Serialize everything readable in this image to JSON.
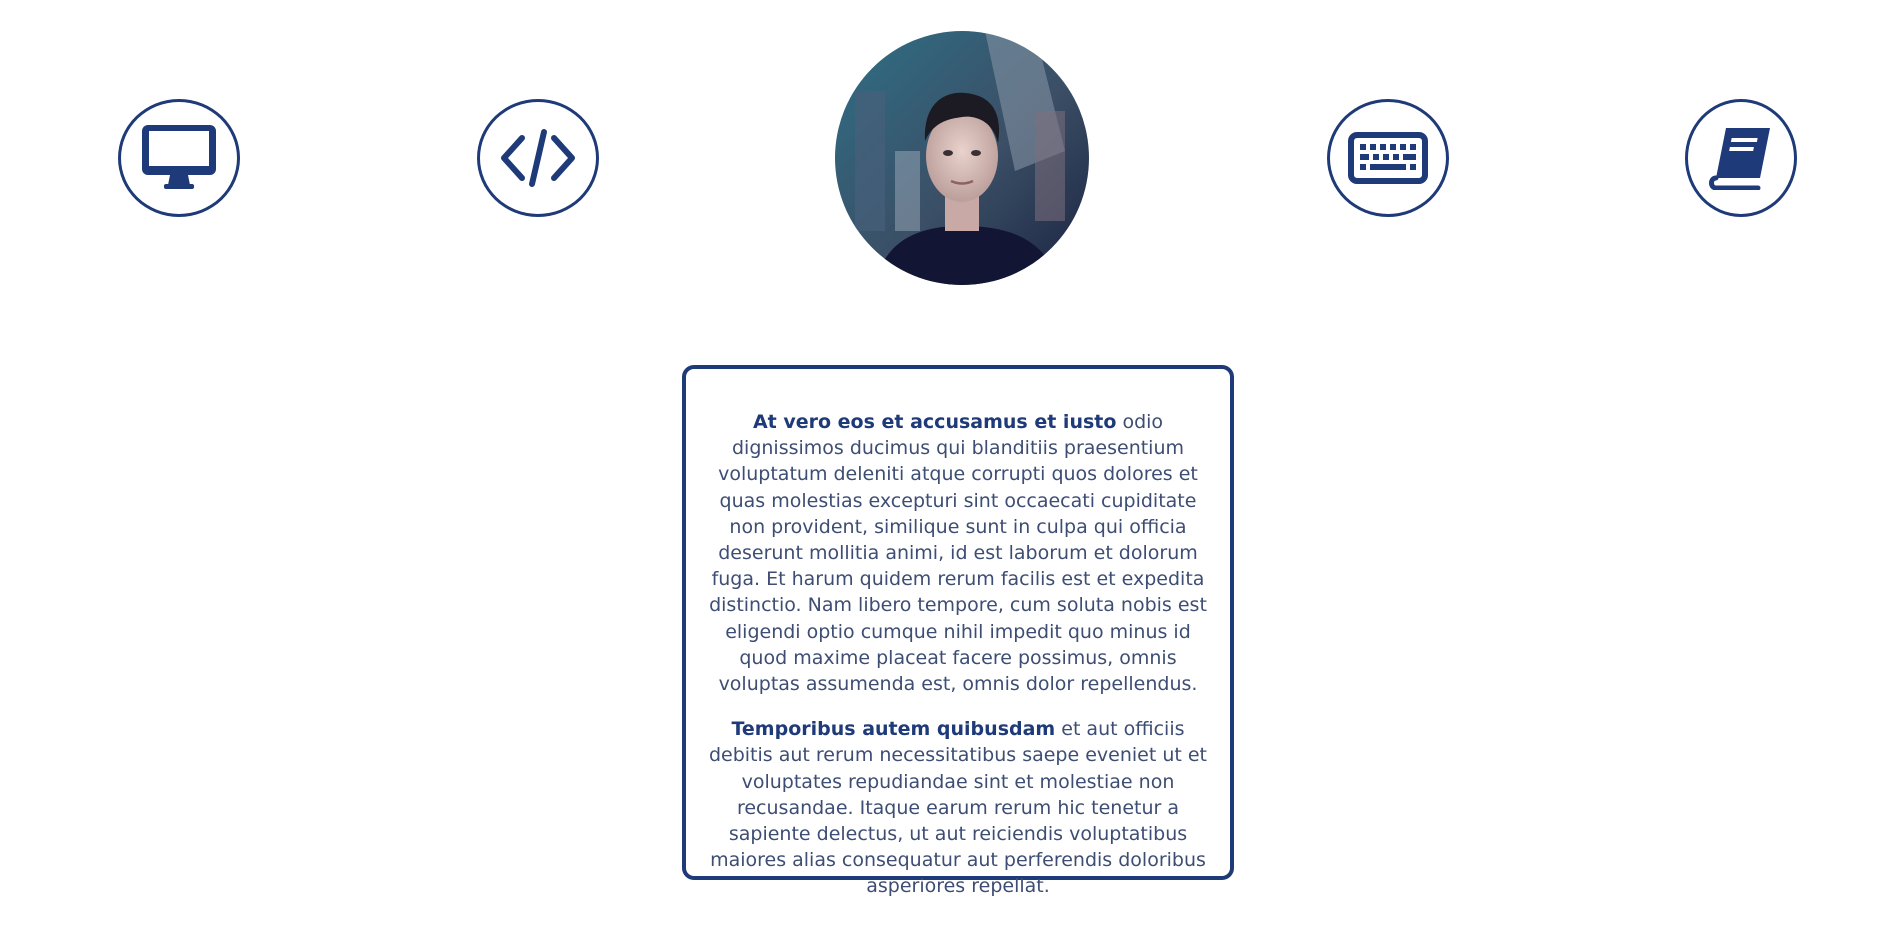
{
  "colors": {
    "accent": "#1f3a78",
    "text": "#3d4d73",
    "background": "#ffffff"
  },
  "icons": [
    {
      "name": "monitor-icon"
    },
    {
      "name": "code-icon"
    },
    {
      "name": "keyboard-icon"
    },
    {
      "name": "book-icon"
    }
  ],
  "avatar": {
    "alt": "Profile photo"
  },
  "about": {
    "paragraph_1": {
      "lead": "At vero eos et accusamus et iusto",
      "body": " odio dignissimos ducimus qui blanditiis praesentium voluptatum deleniti atque corrupti quos dolores et quas molestias excepturi sint occaecati cupiditate non provident, similique sunt in culpa qui officia deserunt mollitia animi, id est laborum et dolorum fuga. Et harum quidem rerum facilis est et expedita distinctio. Nam libero tempore, cum soluta nobis est eligendi optio cumque nihil impedit quo minus id quod maxime placeat facere possimus, omnis voluptas assumenda est, omnis dolor repellendus."
    },
    "paragraph_2": {
      "lead": "Temporibus autem quibusdam",
      "body": " et aut officiis debitis aut rerum necessitatibus saepe eveniet ut et voluptates repudiandae sint et molestiae non recusandae. Itaque earum rerum hic tenetur a sapiente delectus, ut aut reiciendis voluptatibus maiores alias consequatur aut perferendis doloribus asperiores repellat."
    }
  }
}
